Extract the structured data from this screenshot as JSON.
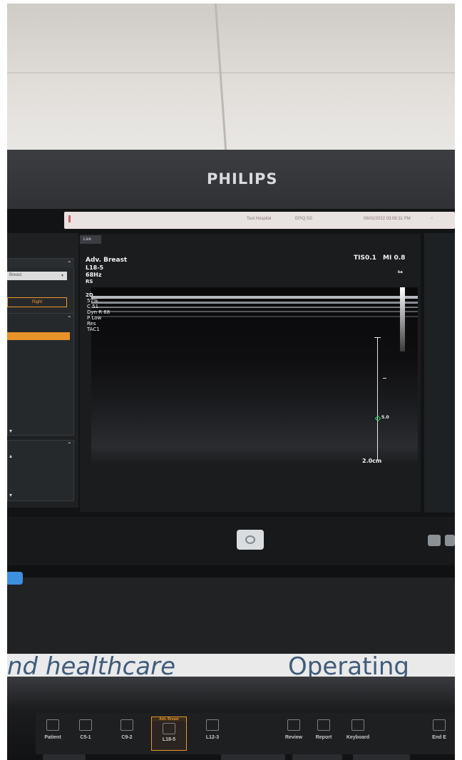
{
  "monitor": {
    "brand": "PHILIPS"
  },
  "topbar": {
    "hospital": "Test Hospital",
    "system": "EPIQ 5G",
    "datetime": "06/01/2022 03:06:31 PM"
  },
  "left_panel": {
    "preset_select": "Breast",
    "side_button": "Right"
  },
  "image": {
    "live_tab": "Live",
    "preset": "Adv. Breast",
    "transducer": "L18-5",
    "frame_rate": "68Hz",
    "rs": "RS",
    "mode": "2D",
    "params": [
      "57%",
      "C 51",
      "Dyn R 68",
      "P Low",
      "Res",
      "TAC1"
    ],
    "tis": "TIS0.1",
    "mi": "MI 0.8",
    "scale_label": "2.0cm",
    "focus_label": "5.0",
    "label_ka": "ka"
  },
  "backdrop": {
    "left_text": "nd healthcare",
    "right_text": "Operating Micro"
  },
  "console": {
    "keys": [
      {
        "label": "Patient",
        "icon": "person-icon"
      },
      {
        "label": "C5-1",
        "icon": "curved-probe-icon"
      },
      {
        "label": "C9-2",
        "icon": "curved-probe-icon"
      },
      {
        "label": "L18-5",
        "top": "Adv. Breast",
        "icon": "linear-probe-icon",
        "selected": true
      },
      {
        "label": "L12-3",
        "icon": "linear-probe-icon"
      },
      {
        "label": "Review",
        "icon": "grid-icon"
      },
      {
        "label": "Report",
        "icon": "document-icon"
      },
      {
        "label": "Keyboard",
        "icon": "keyboard-icon"
      },
      {
        "label": "End E",
        "icon": "folder-icon"
      }
    ]
  }
}
